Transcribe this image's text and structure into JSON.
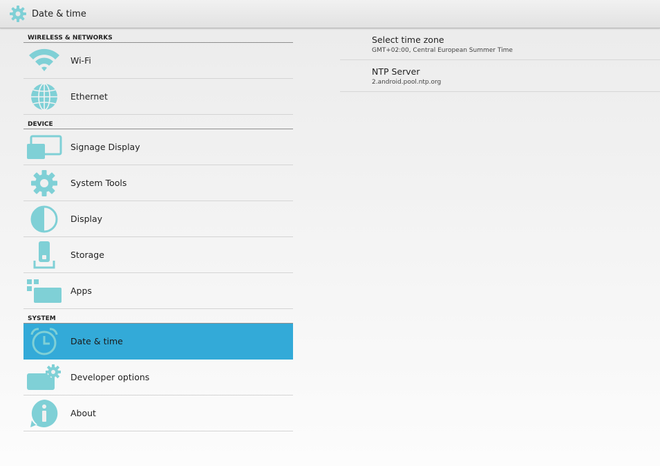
{
  "header": {
    "title": "Date & time",
    "icon": "gear-icon"
  },
  "colors": {
    "accent": "#33aad8",
    "icon": "#7fd0d6"
  },
  "sidebar": {
    "categories": [
      {
        "label": "WIRELESS & NETWORKS"
      },
      {
        "label": "DEVICE"
      },
      {
        "label": "SYSTEM"
      }
    ],
    "items": [
      {
        "label": "Wi-Fi",
        "icon": "wifi-icon"
      },
      {
        "label": "Ethernet",
        "icon": "globe-icon"
      },
      {
        "label": "Signage Display",
        "icon": "display-screen-icon"
      },
      {
        "label": "System Tools",
        "icon": "gear-icon"
      },
      {
        "label": "Display",
        "icon": "brightness-icon"
      },
      {
        "label": "Storage",
        "icon": "storage-icon"
      },
      {
        "label": "Apps",
        "icon": "apps-icon"
      },
      {
        "label": "Date & time",
        "icon": "clock-icon",
        "selected": true
      },
      {
        "label": "Developer options",
        "icon": "developer-gear-icon"
      },
      {
        "label": "About",
        "icon": "info-icon"
      }
    ]
  },
  "detail": {
    "items": [
      {
        "title": "Select time zone",
        "summary": "GMT+02:00, Central European Summer Time"
      },
      {
        "title": "NTP Server",
        "summary": "2.android.pool.ntp.org"
      }
    ]
  }
}
